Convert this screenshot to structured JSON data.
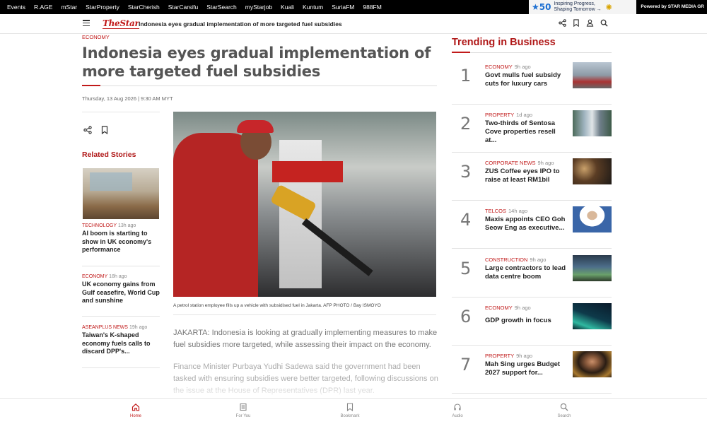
{
  "topbar": {
    "links": [
      "Events",
      "R.AGE",
      "mStar",
      "StarProperty",
      "StarCherish",
      "StarCarsifu",
      "StarSearch",
      "myStarjob",
      "Kuali",
      "Kuntum",
      "SuriaFM",
      "988FM"
    ],
    "promo": {
      "line1": "Inspiring Progress,",
      "line2": "Shaping Tomorrow →"
    },
    "powered": "Powered by STAR MEDIA GR"
  },
  "navbar": {
    "logo": "TheStar",
    "title": "Indonesia eyes gradual implementation of more targeted fuel subsidies"
  },
  "article": {
    "category": "ECONOMY",
    "headline": "Indonesia eyes gradual implementation of more targeted fuel subsidies",
    "date": "Thursday, 13 Aug 2026 | 9:30 AM MYT",
    "caption": "A petrol station employee fills up a vehicle with subsidised fuel in Jakarta. AFP PHOTO / Bay ISMOYO",
    "paragraphs": [
      "JAKARTA: Indonesia is looking at gradually implementing measures to make fuel subsidies more targeted, while assessing their impact on the economy.",
      "Finance Minister Purbaya Yudhi Sadewa said the government had been tasked with ensuring subsidies were better targeted, following discussions on the issue at the House of Representatives (DPR) last year."
    ]
  },
  "related": {
    "title": "Related Stories",
    "items": [
      {
        "category": "TECHNOLOGY",
        "ago": "13h ago",
        "text": "AI boom is starting to show in UK economy's performance"
      },
      {
        "category": "ECONOMY",
        "ago": "18h ago",
        "text": "UK economy gains from Gulf ceasefire, World Cup and sunshine"
      },
      {
        "category": "ASEANPLUS NEWS",
        "ago": "19h ago",
        "text": "Taiwan's K-shaped economy fuels calls to discard DPP's..."
      }
    ]
  },
  "trending": {
    "title": "Trending in Business",
    "items": [
      {
        "num": "1",
        "category": "ECONOMY",
        "ago": "9h ago",
        "text": "Govt mulls fuel subsidy cuts for luxury cars"
      },
      {
        "num": "2",
        "category": "PROPERTY",
        "ago": "1d ago",
        "text": "Two-thirds of Sentosa Cove properties resell at..."
      },
      {
        "num": "3",
        "category": "CORPORATE NEWS",
        "ago": "9h ago",
        "text": "ZUS Coffee eyes IPO to raise at least RM1bil"
      },
      {
        "num": "4",
        "category": "TELCOS",
        "ago": "14h ago",
        "text": "Maxis appoints CEO Goh Seow Eng as executive..."
      },
      {
        "num": "5",
        "category": "CONSTRUCTION",
        "ago": "9h ago",
        "text": "Large contractors to lead data centre boom"
      },
      {
        "num": "6",
        "category": "ECONOMY",
        "ago": "9h ago",
        "text": "GDP growth in focus"
      },
      {
        "num": "7",
        "category": "PROPERTY",
        "ago": "9h ago",
        "text": "Mah Sing urges Budget 2027 support for..."
      }
    ]
  },
  "bottomnav": {
    "tabs": [
      {
        "label": "Home",
        "icon": "home-icon"
      },
      {
        "label": "For You",
        "icon": "newspaper-icon"
      },
      {
        "label": "Bookmark",
        "icon": "bookmark-icon"
      },
      {
        "label": "Audio",
        "icon": "headphones-icon"
      },
      {
        "label": "Search",
        "icon": "search-icon"
      }
    ]
  },
  "colors": {
    "accent": "#c11a1a",
    "topbar": "#000000"
  }
}
